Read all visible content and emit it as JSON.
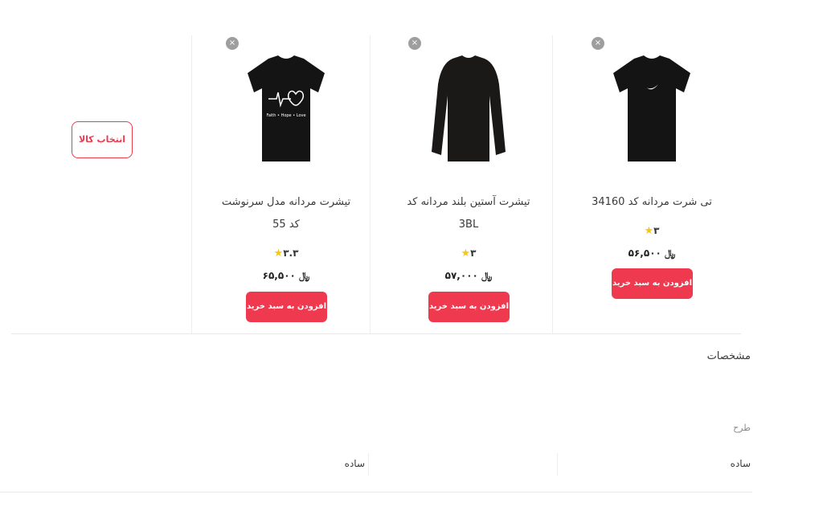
{
  "products": [
    {
      "title": "تی شرت مردانه کد 34160",
      "rating": "۳",
      "price": "۵۶,۵۰۰",
      "currency": "﷼",
      "cart_label": "افزودن به سبد خرید",
      "print": "",
      "remove_label": "×"
    },
    {
      "title": "تیشرت آستین بلند مردانه کد",
      "subtitle": "3BL",
      "rating": "۳",
      "price": "۵۷,۰۰۰",
      "currency": "﷼",
      "cart_label": "افزودن به سبد خرید",
      "remove_label": "×"
    },
    {
      "title": "تیشرت مردانه مدل سرنوشت",
      "subtitle": "کد 55",
      "rating": "۳.۳",
      "price": "۶۵,۵۰۰",
      "currency": "﷼",
      "cart_label": "افزودن به سبد خرید",
      "print": "Faith • Hope • Love",
      "remove_label": "×"
    }
  ],
  "select_product_label": "انتخاب کالا",
  "specs": {
    "heading": "مشخصات",
    "rows": [
      {
        "label": "طرح",
        "values": [
          "ساده",
          "ساده"
        ]
      }
    ]
  },
  "colors": {
    "accent": "#ef394e",
    "star": "#f5c518",
    "remove": "#9e9e9e"
  },
  "icons": {
    "star": "star-icon",
    "remove": "close-icon"
  }
}
